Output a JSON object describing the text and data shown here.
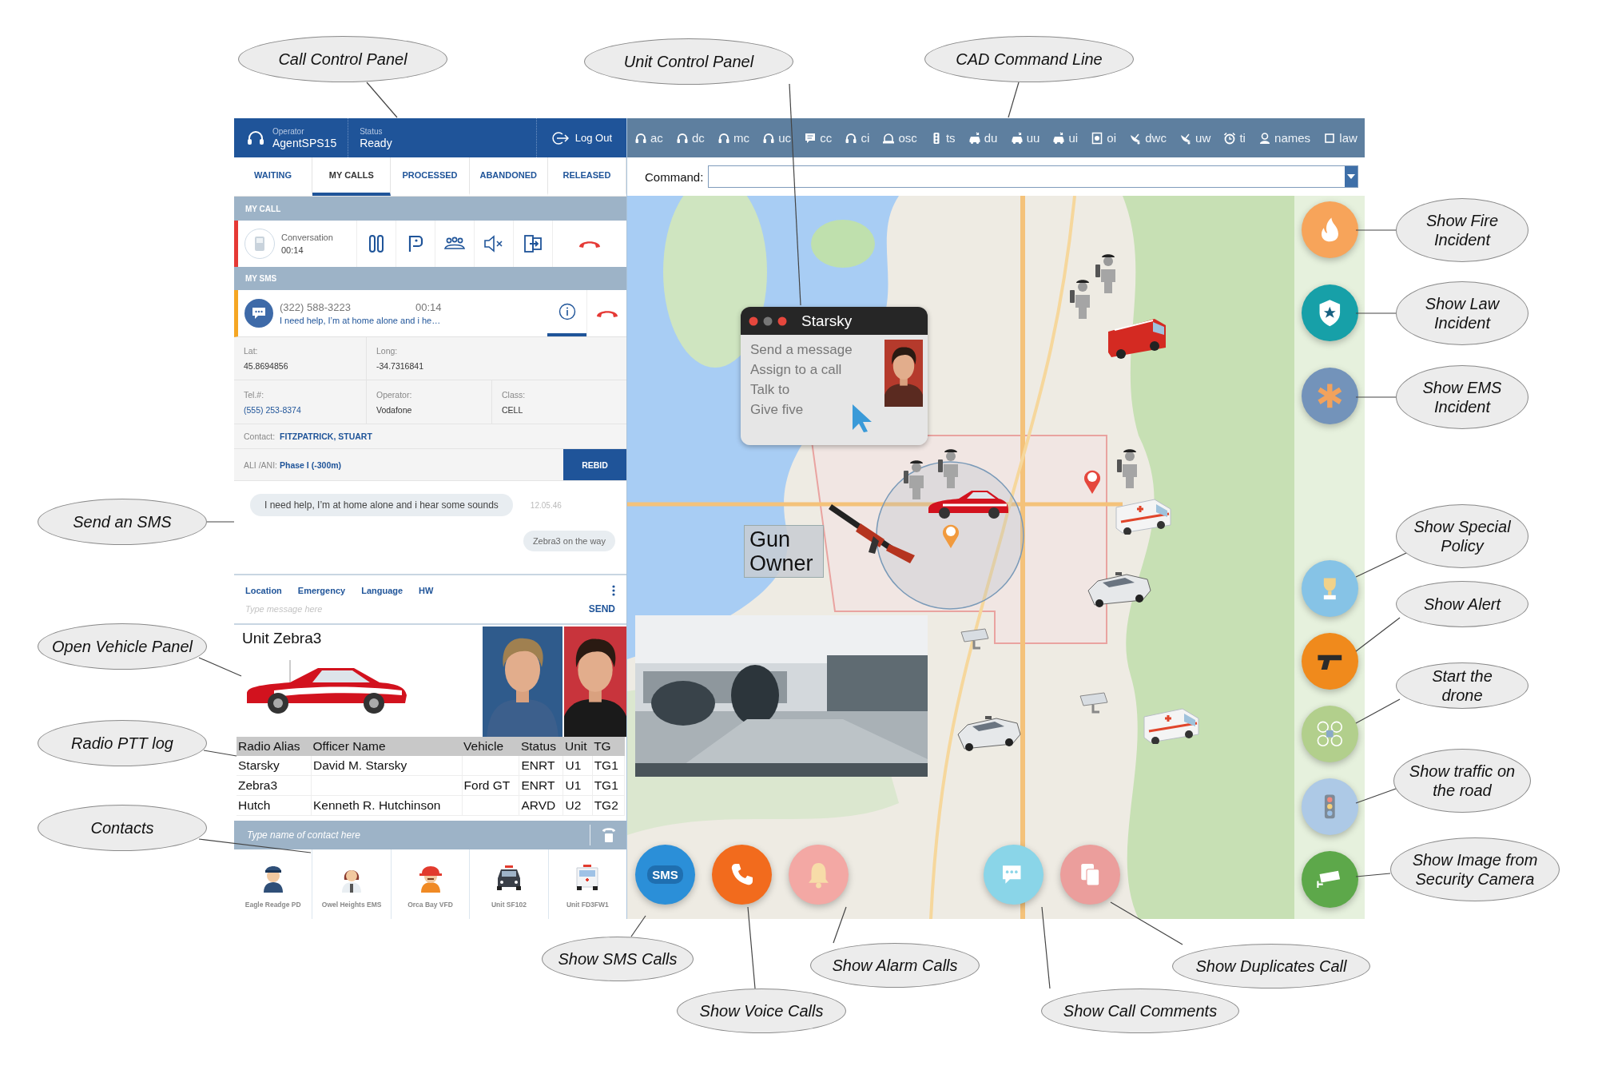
{
  "callouts": [
    "Call Control Panel",
    "Unit Control Panel",
    "CAD Command Line",
    "Show Fire Incident",
    "Show Law Incident",
    "Show EMS Incident",
    "Show Special Policy",
    "Show Alert",
    "Start the drone",
    "Show traffic on the road",
    "Show Image from Security Camera",
    "Send an SMS",
    "Open Vehicle Panel",
    "Radio PTT log",
    "Contacts",
    "Show SMS Calls",
    "Show Voice Calls",
    "Show Alarm Calls",
    "Show Call Comments",
    "Show Duplicates Call"
  ],
  "operator": {
    "label": "Operator",
    "value": "AgentSPS15"
  },
  "status": {
    "label": "Status",
    "value": "Ready"
  },
  "logout": "Log Out",
  "tabs": [
    {
      "label": "WAITING",
      "selected": false
    },
    {
      "label": "MY CALLS",
      "selected": true
    },
    {
      "label": "PROCESSED",
      "selected": false
    },
    {
      "label": "ABANDONED",
      "selected": false
    },
    {
      "label": "RELEASED",
      "selected": false
    }
  ],
  "my_call": {
    "heading": "MY CALL",
    "state": "Conversation",
    "duration": "00:14"
  },
  "sms": {
    "heading": "MY SMS",
    "number": "(322) 588-3223",
    "time": "00:14",
    "preview": "I need help, I’m at home alone and i he…",
    "info_selected": true
  },
  "location_rows": [
    [
      {
        "label": "Lat:",
        "value": "45.8694856",
        "kind": "plain"
      },
      {
        "label": "Long:",
        "value": "-34.7316841",
        "kind": "plain"
      }
    ],
    [
      {
        "label": "Tel.#:",
        "value": "(555) 253-8374",
        "kind": "link"
      },
      {
        "label": "Operator:",
        "value": "Vodafone",
        "kind": "plain"
      },
      {
        "label": "Class:",
        "value": "CELL",
        "kind": "plain"
      }
    ]
  ],
  "contact": {
    "label": "Contact:",
    "value": "FITZPATRICK, STUART"
  },
  "ali": {
    "label": "ALI /ANI:",
    "value": "Phase I (-300m)"
  },
  "rebid": "REBID",
  "messages": [
    {
      "kind": "incoming",
      "text": "I need help, I’m at home alone and i hear some sounds",
      "time": "12.05.46"
    },
    {
      "kind": "outgoing",
      "text": "Zebra3 on the way"
    }
  ],
  "quick_tabs": [
    "Location",
    "Emergency",
    "Language",
    "HW"
  ],
  "message_input": {
    "placeholder": "Type message here"
  },
  "send": "SEND",
  "unit": {
    "title": "Unit Zebra3"
  },
  "table": {
    "columns": [
      "Radio Alias",
      "Officer Name",
      "Vehicle",
      "Status",
      "Unit",
      "TG"
    ],
    "rows": [
      [
        "Starsky",
        "David M. Starsky",
        "",
        "ENRT",
        "U1",
        "TG1"
      ],
      [
        "Zebra3",
        "",
        "Ford GT",
        "ENRT",
        "U1",
        "TG1"
      ],
      [
        "Hutch",
        "Kenneth R. Hutchinson",
        "",
        "ARVD",
        "U2",
        "TG2"
      ]
    ]
  },
  "contact_search": {
    "placeholder": "Type name of contact here"
  },
  "contacts": [
    {
      "label": "Eagle Readge PD",
      "kind": "police-officer"
    },
    {
      "label": "Owel Heights EMS",
      "kind": "medic"
    },
    {
      "label": "Orca Bay VFD",
      "kind": "firefighter"
    },
    {
      "label": "Unit SF102",
      "kind": "police-car"
    },
    {
      "label": "Unit FD3FW1",
      "kind": "ambulance"
    }
  ],
  "toolbar": [
    {
      "label": "ac",
      "kind": "headset"
    },
    {
      "label": "dc",
      "kind": "headset"
    },
    {
      "label": "mc",
      "kind": "headset"
    },
    {
      "label": "uc",
      "kind": "headset"
    },
    {
      "label": "cc",
      "kind": "comment"
    },
    {
      "label": "ci",
      "kind": "headset"
    },
    {
      "label": "osc",
      "kind": "siren"
    },
    {
      "label": "ts",
      "kind": "traffic-light"
    },
    {
      "label": "du",
      "kind": "car"
    },
    {
      "label": "uu",
      "kind": "car"
    },
    {
      "label": "ui",
      "kind": "car"
    },
    {
      "label": "oi",
      "kind": "document"
    },
    {
      "label": "dwc",
      "kind": "dish"
    },
    {
      "label": "uw",
      "kind": "dish"
    },
    {
      "label": "ti",
      "kind": "clock"
    },
    {
      "label": "names",
      "kind": "person"
    },
    {
      "label": "law",
      "kind": "square"
    }
  ],
  "command": {
    "label": "Command:"
  },
  "map_popup": {
    "title": "Starsky",
    "actions": [
      "Send a message",
      "Assign to a call",
      "Talk to",
      "Give five"
    ]
  },
  "map_tag": "Gun Owner",
  "incident_buttons": [
    {
      "kind": "fire"
    },
    {
      "kind": "law"
    },
    {
      "kind": "ems"
    }
  ],
  "tool_buttons": [
    {
      "kind": "trophy"
    },
    {
      "kind": "gun"
    },
    {
      "kind": "drone"
    },
    {
      "kind": "traffic"
    },
    {
      "kind": "camera"
    }
  ],
  "call_buttons": [
    {
      "kind": "sms",
      "label": "SMS"
    },
    {
      "kind": "voice"
    },
    {
      "kind": "alarm"
    }
  ],
  "note_buttons": [
    {
      "kind": "comments"
    },
    {
      "kind": "duplicates"
    }
  ]
}
